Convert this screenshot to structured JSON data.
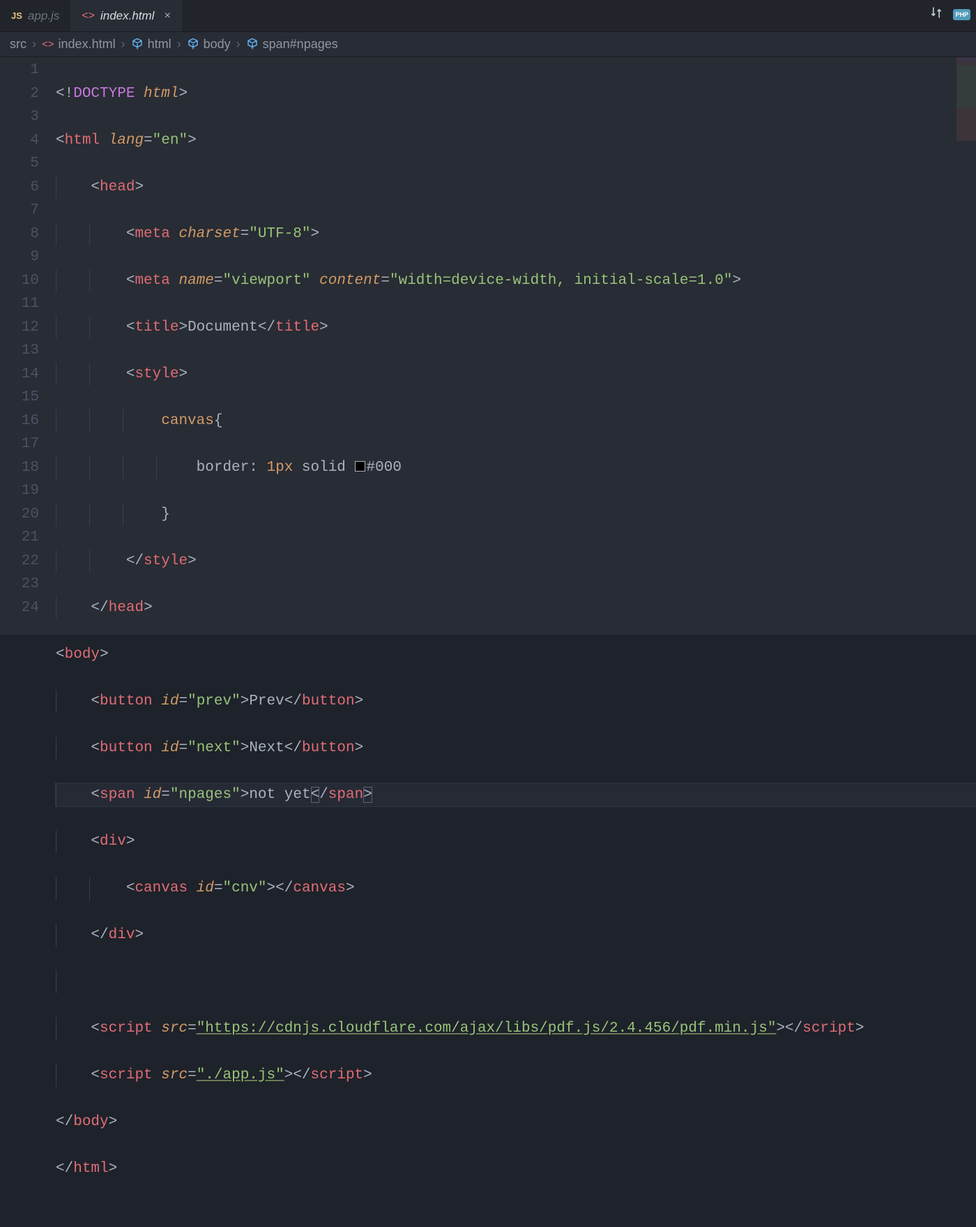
{
  "tabs": [
    {
      "icon": "JS",
      "label": "app.js",
      "active": false
    },
    {
      "icon": "<>",
      "label": "index.html",
      "active": true,
      "closeable": true
    }
  ],
  "topright": {
    "compare_icon": "⇅",
    "php_badge": "PHP"
  },
  "breadcrumbs": {
    "items": [
      {
        "label": "src",
        "icon": null
      },
      {
        "label": "index.html",
        "icon": "html"
      },
      {
        "label": "html",
        "icon": "cube"
      },
      {
        "label": "body",
        "icon": "cube"
      },
      {
        "label": "span#npages",
        "icon": "cube"
      }
    ],
    "separator": "›"
  },
  "lineNumbers": [
    "1",
    "2",
    "3",
    "4",
    "5",
    "6",
    "7",
    "8",
    "9",
    "10",
    "11",
    "12",
    "13",
    "14",
    "15",
    "16",
    "17",
    "18",
    "19",
    "20",
    "21",
    "22",
    "23",
    "24"
  ],
  "highlightedLine": 16,
  "code": {
    "l1": {
      "p1": "<!",
      "doctype": "DOCTYPE",
      "sp": " ",
      "htmlw": "html",
      "p2": ">"
    },
    "l2": {
      "open": "<",
      "tag": "html",
      "attr": "lang",
      "eq": "=",
      "val": "\"en\"",
      "close": ">"
    },
    "l3": {
      "open": "<",
      "tag": "head",
      "close": ">"
    },
    "l4": {
      "open": "<",
      "tag": "meta",
      "attr": "charset",
      "eq": "=",
      "val": "\"UTF-8\"",
      "close": ">"
    },
    "l5": {
      "open": "<",
      "tag": "meta",
      "attr1": "name",
      "val1": "\"viewport\"",
      "attr2": "content",
      "val2": "\"width=device-width, initial-scale=1.0\"",
      "close": ">"
    },
    "l6": {
      "open": "<",
      "tag": "title",
      "gt": ">",
      "text": "Document",
      "co": "</",
      "ctag": "title",
      "cgt": ">"
    },
    "l7": {
      "open": "<",
      "tag": "style",
      "close": ">"
    },
    "l8": {
      "sel": "canvas",
      "brace": "{"
    },
    "l9": {
      "prop": "border",
      "colon": ": ",
      "num": "1px",
      "solid": " solid ",
      "hex": "#000"
    },
    "l10": {
      "brace": "}"
    },
    "l11": {
      "open": "</",
      "tag": "style",
      "close": ">"
    },
    "l12": {
      "open": "</",
      "tag": "head",
      "close": ">"
    },
    "l13": {
      "open": "<",
      "tag": "body",
      "close": ">"
    },
    "l14": {
      "open": "<",
      "tag": "button",
      "attr": "id",
      "val": "\"prev\"",
      "gt": ">",
      "text": "Prev",
      "co": "</",
      "ctag": "button",
      "cgt": ">"
    },
    "l15": {
      "open": "<",
      "tag": "button",
      "attr": "id",
      "val": "\"next\"",
      "gt": ">",
      "text": "Next",
      "co": "</",
      "ctag": "button",
      "cgt": ">"
    },
    "l16": {
      "open": "<",
      "tag": "span",
      "attr": "id",
      "val": "\"npages\"",
      "gt": ">",
      "text": "not yet",
      "colt": "<",
      "cslash": "/",
      "ctag": "span",
      "cgt": ">"
    },
    "l17": {
      "open": "<",
      "tag": "div",
      "close": ">"
    },
    "l18": {
      "open": "<",
      "tag": "canvas",
      "attr": "id",
      "val": "\"cnv\"",
      "gt": ">",
      "co": "</",
      "ctag": "canvas",
      "cgt": ">"
    },
    "l19": {
      "open": "</",
      "tag": "div",
      "close": ">"
    },
    "l21": {
      "open": "<",
      "tag": "script",
      "attr": "src",
      "val": "\"https://cdnjs.cloudflare.com/ajax/libs/pdf.js/2.4.456/pdf.min.js\"",
      "gt": ">",
      "co": "</",
      "ctag": "script",
      "cgt": ">"
    },
    "l22": {
      "open": "<",
      "tag": "script",
      "attr": "src",
      "val": "\"./app.js\"",
      "gt": ">",
      "co": "</",
      "ctag": "script",
      "cgt": ">"
    },
    "l23": {
      "open": "</",
      "tag": "body",
      "close": ">"
    },
    "l24": {
      "open": "</",
      "tag": "html",
      "close": ">"
    }
  }
}
